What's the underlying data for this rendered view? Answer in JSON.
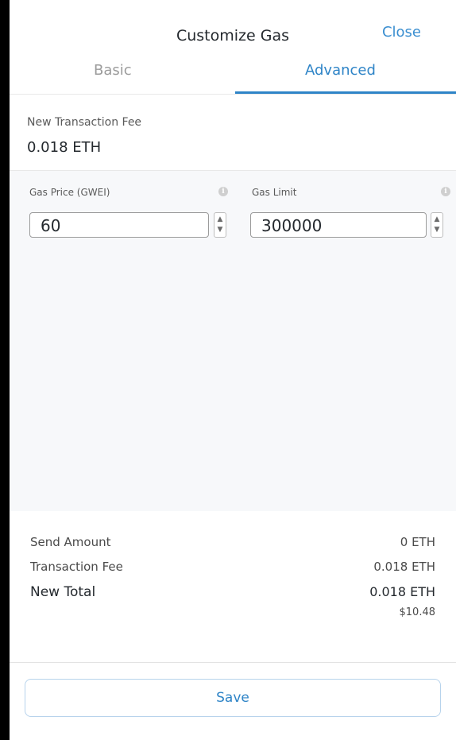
{
  "header": {
    "title": "Customize Gas",
    "close_label": "Close"
  },
  "tabs": [
    {
      "label": "Basic",
      "active": false
    },
    {
      "label": "Advanced",
      "active": true
    }
  ],
  "fee": {
    "label": "New Transaction Fee",
    "value": "0.018 ETH"
  },
  "gas_price": {
    "label": "Gas Price (GWEI)",
    "value": "60",
    "info_icon": "info-icon"
  },
  "gas_limit": {
    "label": "Gas Limit",
    "value": "300000",
    "info_icon": "info-icon"
  },
  "summary": {
    "send_amount_label": "Send Amount",
    "send_amount_value": "0 ETH",
    "transaction_fee_label": "Transaction Fee",
    "transaction_fee_value": "0.018 ETH",
    "new_total_label": "New Total",
    "new_total_value": "0.018 ETH",
    "new_total_usd": "$10.48"
  },
  "save_label": "Save",
  "colors": {
    "accent": "#2e84c7",
    "background": "#000000",
    "panel": "#ffffff",
    "inputs_area": "#f7f8fa"
  }
}
